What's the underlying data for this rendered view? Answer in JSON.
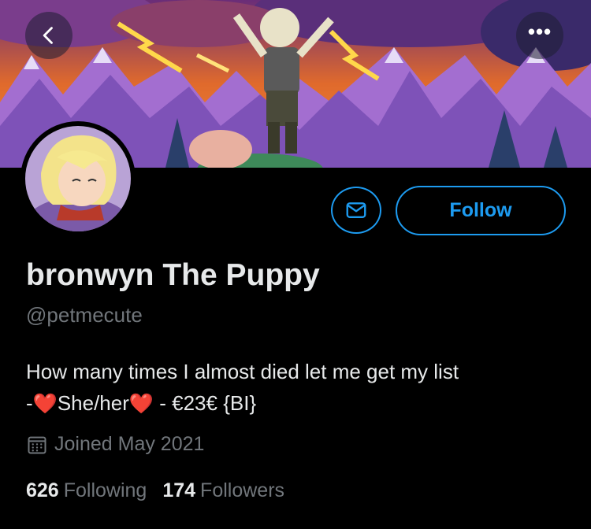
{
  "nav": {
    "back_icon": "chevron-left-icon",
    "more_icon": "more-horizontal-icon",
    "more_label": "•••"
  },
  "profile": {
    "display_name": "bronwyn The Puppy",
    "handle": "@petmecute",
    "bio_line1": "How many times I almost died let me get my list",
    "bio_line2_prefix": "-",
    "bio_pronouns": "She/her",
    "bio_line2_suffix": " - €23€ {BI}",
    "heart_glyph": "❤️",
    "joined": "Joined May 2021"
  },
  "actions": {
    "follow_label": "Follow",
    "message_icon": "envelope-icon"
  },
  "stats": {
    "following_count": "626",
    "following_label": "Following",
    "followers_count": "174",
    "followers_label": "Followers"
  },
  "colors": {
    "accent": "#1d9bf0",
    "muted": "#71767b",
    "text": "#e7e9ea",
    "background": "#000000"
  }
}
